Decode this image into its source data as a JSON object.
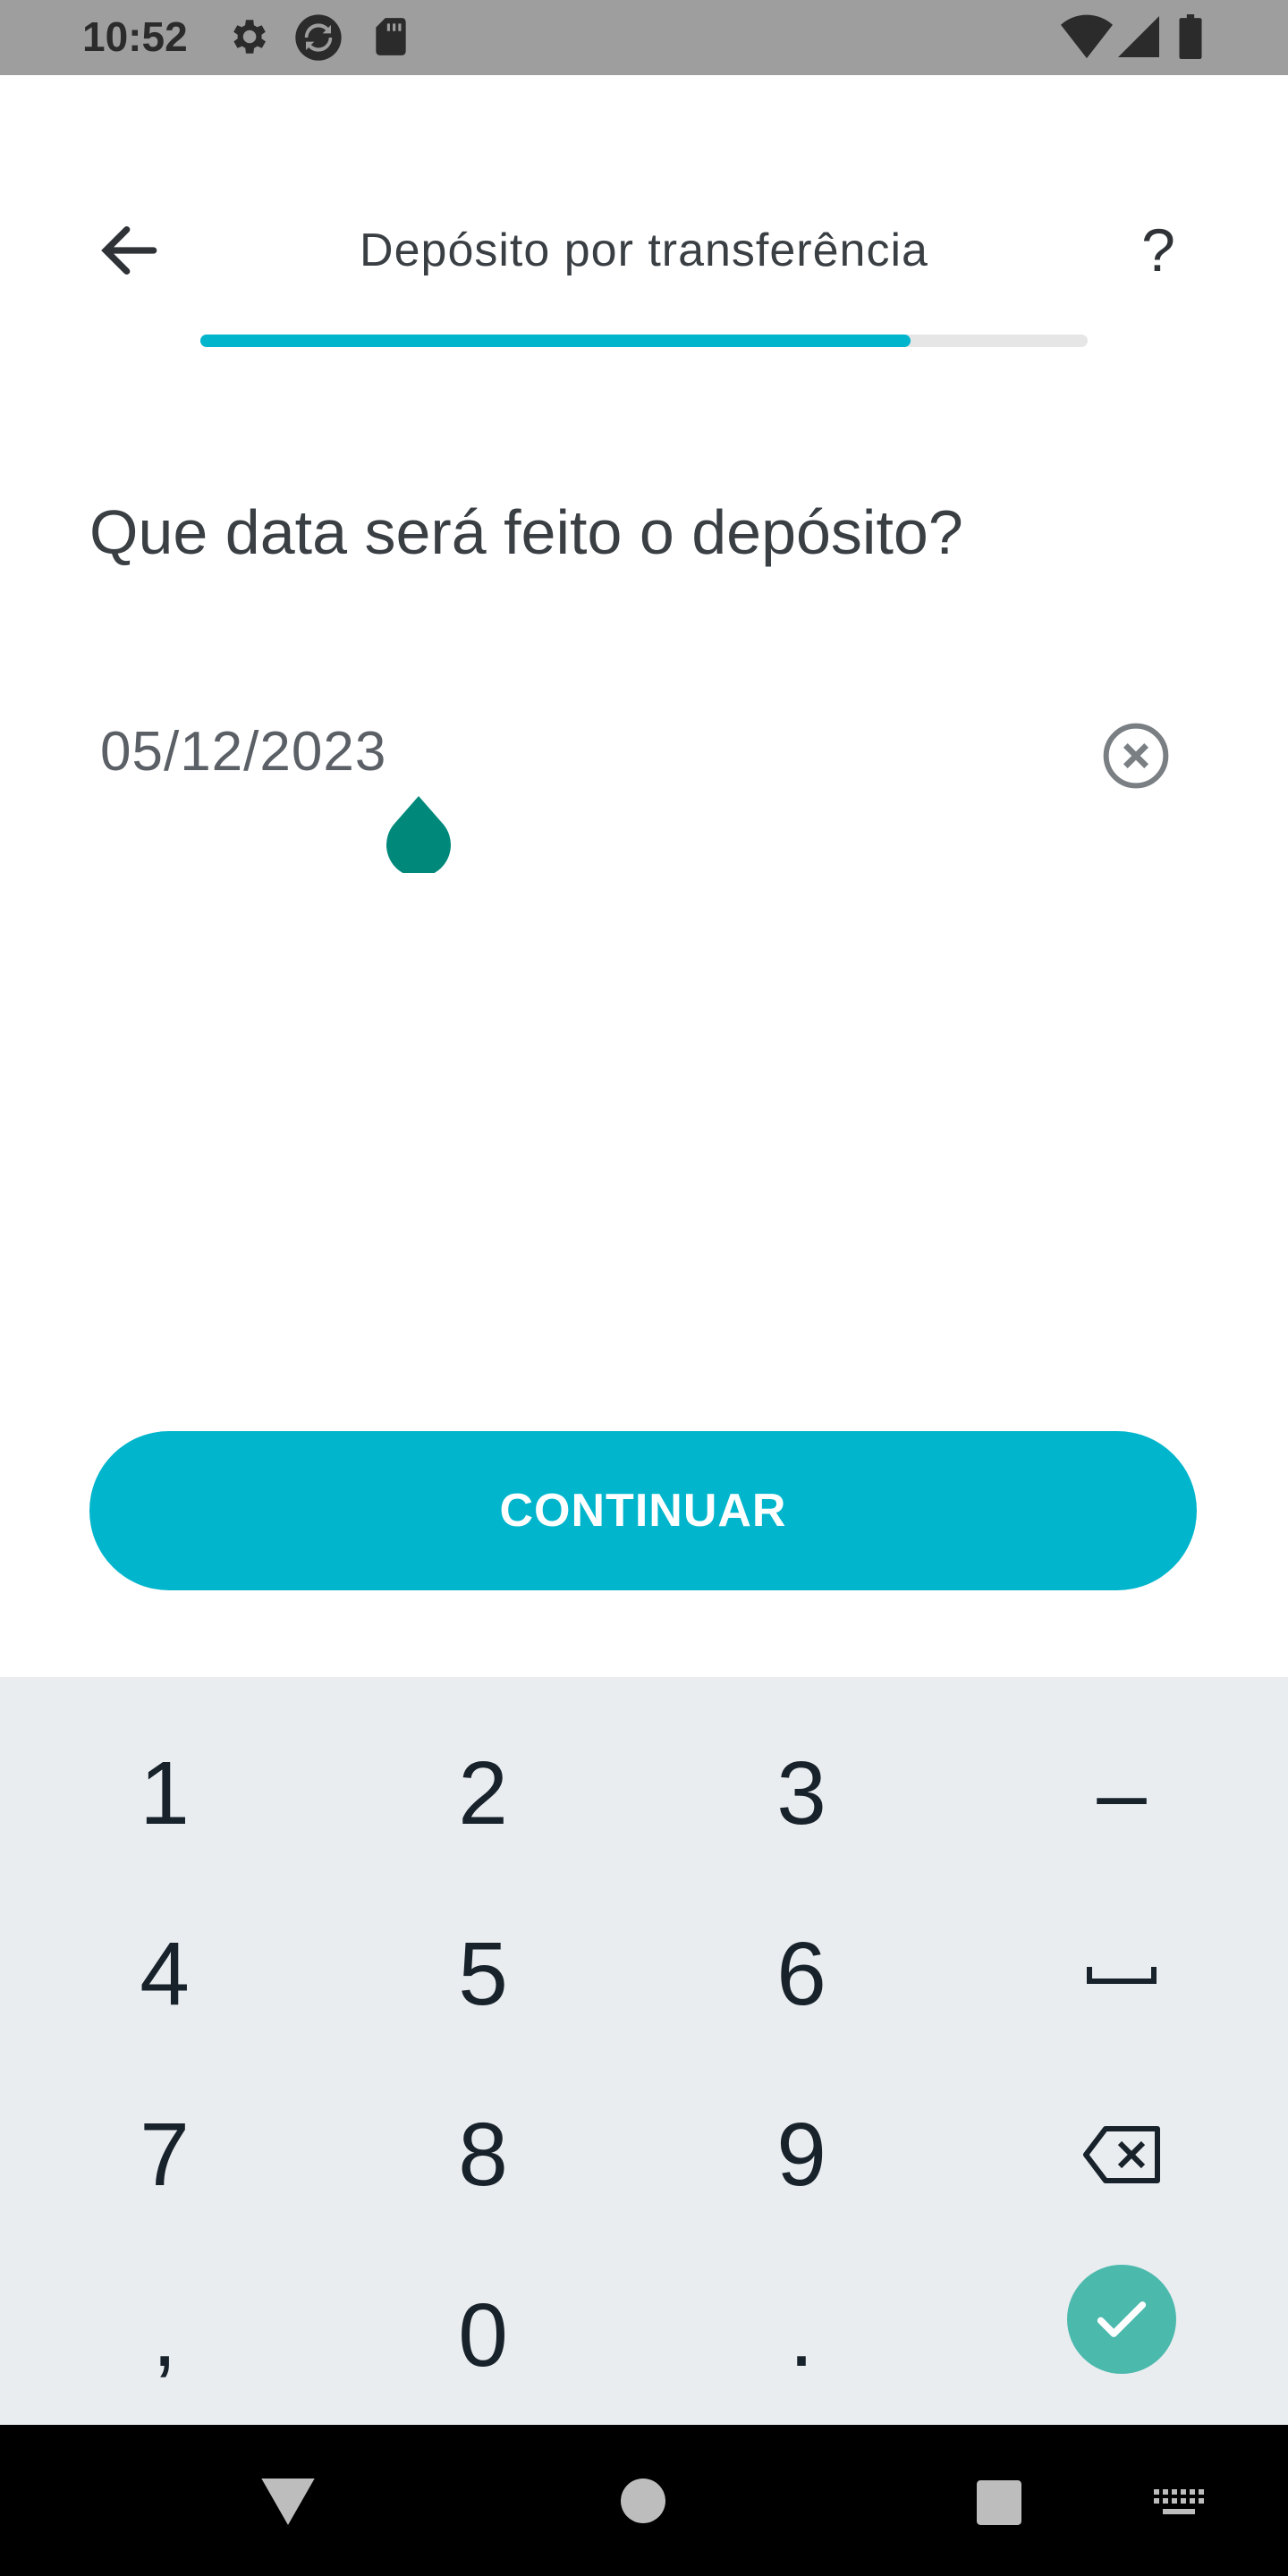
{
  "status_bar": {
    "time": "10:52",
    "icons_left": [
      "gear-icon",
      "sync-icon",
      "sd-card-icon"
    ],
    "icons_right": [
      "wifi-icon",
      "signal-icon",
      "battery-icon"
    ]
  },
  "header": {
    "title": "Depósito por transferência",
    "back_icon": "arrow-left-icon",
    "help_label": "?",
    "progress_percent": 80,
    "accent_color": "#00b5cc"
  },
  "question": "Que data será feito o depósito?",
  "date_input": {
    "value": "05/12/2023",
    "clear_icon": "clear-circle-icon",
    "handle_color": "#00897b"
  },
  "continue_button": {
    "label": "CONTINUAR"
  },
  "keyboard": {
    "rows": [
      [
        "1",
        "2",
        "3",
        "–"
      ],
      [
        "4",
        "5",
        "6",
        "␣"
      ],
      [
        "7",
        "8",
        "9",
        "⌫"
      ],
      [
        ",",
        "0",
        ".",
        "✓"
      ]
    ],
    "enter_color": "#4cb9ad"
  },
  "nav_bar": {
    "icons": [
      "back-triangle-icon",
      "home-circle-icon",
      "recents-square-icon",
      "keyboard-switch-icon"
    ]
  }
}
